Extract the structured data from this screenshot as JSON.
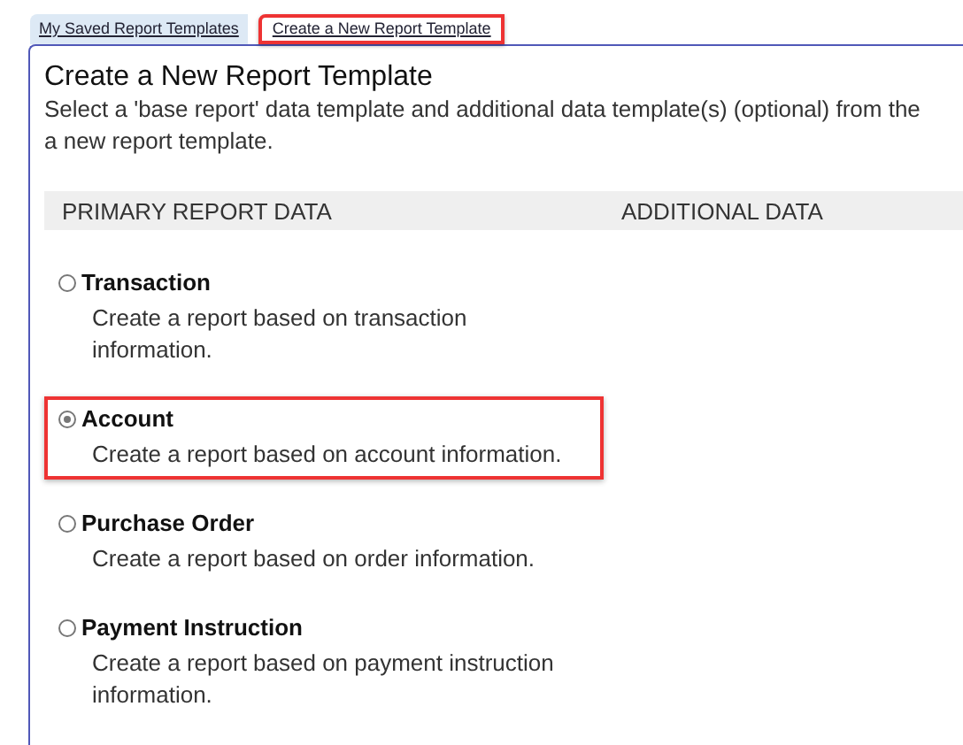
{
  "tabs": [
    {
      "label": "My Saved Report Templates",
      "selected": false,
      "highlighted": false
    },
    {
      "label": "Create a New Report Template",
      "selected": true,
      "highlighted": true
    }
  ],
  "title": "Create a New Report Template",
  "description": "Select a 'base report' data template and additional data template(s) (optional) from the\na new report template.",
  "columns": [
    "PRIMARY REPORT DATA",
    "ADDITIONAL DATA"
  ],
  "options": [
    {
      "label": "Transaction",
      "description": "Create a report based on transaction information.",
      "selected": false,
      "highlighted": false
    },
    {
      "label": "Account",
      "description": "Create a report based on account information.",
      "selected": true,
      "highlighted": true
    },
    {
      "label": "Purchase Order",
      "description": "Create a report based on order information.",
      "selected": false,
      "highlighted": false
    },
    {
      "label": "Payment Instruction",
      "description": "Create a report based on payment instruction information.",
      "selected": false,
      "highlighted": false
    }
  ]
}
